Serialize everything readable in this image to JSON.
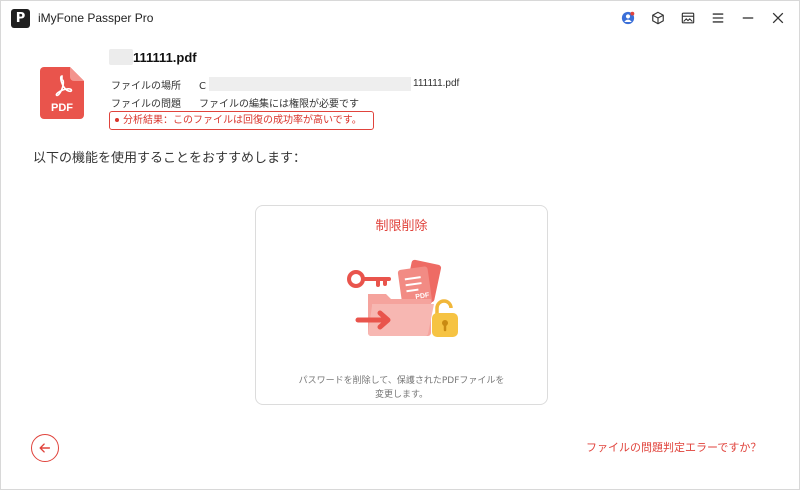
{
  "app": {
    "logo_letter": "P",
    "title": "iMyFone Passper Pro"
  },
  "file": {
    "name": "111111.pdf",
    "icon_label": "PDF",
    "location_label": "ファイルの場所",
    "location_value_prefix": "C",
    "location_value_suffix": "111111.pdf",
    "problem_label": "ファイルの問題",
    "problem_value": "ファイルの編集には権限が必要です",
    "analysis": "分析結果：このファイルは回復の成功率が高いです。"
  },
  "recommend_text": "以下の機能を使用することをおすすめします：",
  "card": {
    "title": "制限削除",
    "illus_label": "PDF",
    "desc_line1": "パスワードを削除して、保護されたPDFファイルを",
    "desc_line2": "変更します。"
  },
  "footer": {
    "help_link": "ファイルの問題判定エラーですか？"
  },
  "colors": {
    "accent": "#e0433c",
    "text": "#333333"
  },
  "icons": [
    "user-icon",
    "cube-icon",
    "image-icon",
    "menu-icon",
    "minimize-icon",
    "close-icon",
    "back-arrow-icon",
    "pdf-file-icon",
    "unlock-illustration"
  ]
}
